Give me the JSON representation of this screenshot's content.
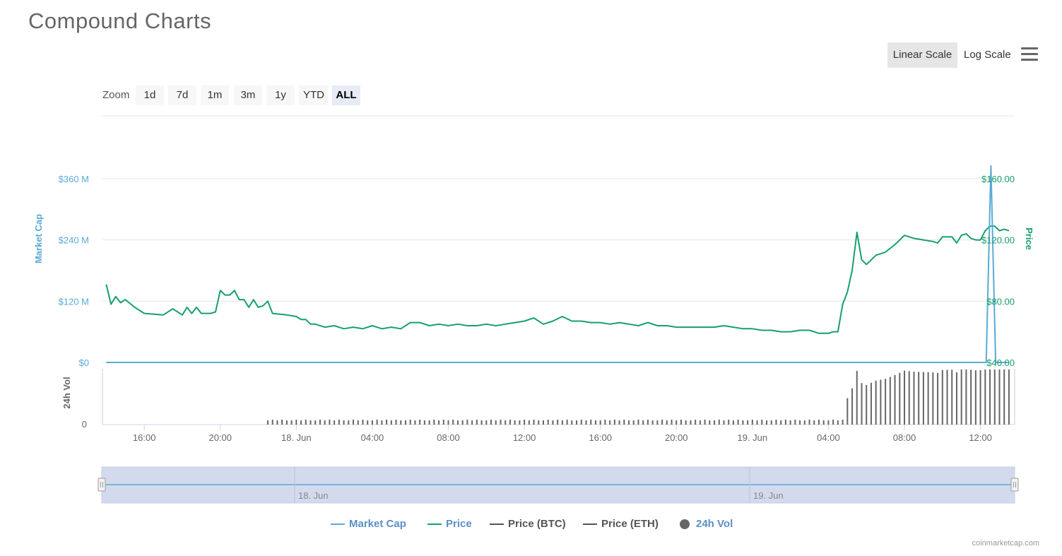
{
  "title": "Compound Charts",
  "scale_buttons": {
    "linear": "Linear Scale",
    "log": "Log Scale"
  },
  "menu_icon": "hamburger-menu-icon",
  "zoom": {
    "label": "Zoom",
    "buttons": [
      "1d",
      "7d",
      "1m",
      "3m",
      "1y",
      "YTD",
      "ALL"
    ],
    "active": "ALL"
  },
  "legend": [
    {
      "name": "Market Cap",
      "color": "#5aaad5",
      "kind": "line"
    },
    {
      "name": "Price",
      "color": "#16a06c",
      "kind": "line"
    },
    {
      "name": "Price (BTC)",
      "color": "#555555",
      "kind": "line"
    },
    {
      "name": "Price (ETH)",
      "color": "#555555",
      "kind": "line"
    },
    {
      "name": "24h Vol",
      "color": "#666666",
      "kind": "dot"
    }
  ],
  "credits": "coinmarketcap.com",
  "chart_data": {
    "type": "line",
    "x_ticks": [
      "16:00",
      "20:00",
      "18. Jun",
      "04:00",
      "08:00",
      "12:00",
      "16:00",
      "20:00",
      "19. Jun",
      "04:00",
      "08:00",
      "12:00"
    ],
    "x_range_hours": [
      -2.2,
      45.8
    ],
    "left_axis": {
      "label": "Market Cap",
      "ticks": [
        "$0",
        "$120 M",
        "$240 M",
        "$360 M"
      ],
      "values": [
        0,
        120,
        240,
        360
      ],
      "color": "#5aaad5"
    },
    "right_axis": {
      "label": "Price",
      "ticks": [
        "$40.00",
        "$80.00",
        "$120.00",
        "$160.00"
      ],
      "values": [
        40,
        80,
        120,
        160
      ],
      "color": "#16a06c"
    },
    "volume_axis": {
      "label": "24h Vol",
      "ticks": [
        "0"
      ]
    },
    "series": [
      {
        "name": "Price",
        "color": "#16a06c",
        "points": [
          [
            -2,
            91
          ],
          [
            -1.75,
            78
          ],
          [
            -1.5,
            83
          ],
          [
            -1.25,
            79
          ],
          [
            -1,
            81
          ],
          [
            -0.5,
            76
          ],
          [
            0,
            72
          ],
          [
            1,
            71
          ],
          [
            1.5,
            75
          ],
          [
            2,
            71
          ],
          [
            2.25,
            76
          ],
          [
            2.5,
            72
          ],
          [
            2.75,
            76
          ],
          [
            3,
            72
          ],
          [
            3.5,
            72
          ],
          [
            3.75,
            73
          ],
          [
            4,
            87
          ],
          [
            4.25,
            84
          ],
          [
            4.5,
            84
          ],
          [
            4.75,
            87
          ],
          [
            5,
            81
          ],
          [
            5.25,
            81
          ],
          [
            5.5,
            76
          ],
          [
            5.75,
            81
          ],
          [
            6,
            76
          ],
          [
            6.25,
            77
          ],
          [
            6.5,
            80
          ],
          [
            6.75,
            72
          ],
          [
            7.5,
            71
          ],
          [
            8,
            70
          ],
          [
            8.25,
            68
          ],
          [
            8.5,
            68
          ],
          [
            8.75,
            65
          ],
          [
            9,
            65
          ],
          [
            9.5,
            63
          ],
          [
            10,
            64
          ],
          [
            10.5,
            62
          ],
          [
            11,
            63
          ],
          [
            11.5,
            62
          ],
          [
            12,
            64
          ],
          [
            12.5,
            62
          ],
          [
            13,
            63
          ],
          [
            13.5,
            62
          ],
          [
            14,
            66
          ],
          [
            14.5,
            66
          ],
          [
            15,
            64
          ],
          [
            15.5,
            65
          ],
          [
            16,
            64
          ],
          [
            16.5,
            65
          ],
          [
            17,
            64
          ],
          [
            17.5,
            64
          ],
          [
            18,
            65
          ],
          [
            18.5,
            64
          ],
          [
            19,
            65
          ],
          [
            19.5,
            66
          ],
          [
            20,
            67
          ],
          [
            20.5,
            69
          ],
          [
            21,
            65
          ],
          [
            21.5,
            67
          ],
          [
            22,
            70
          ],
          [
            22.5,
            67
          ],
          [
            23,
            67
          ],
          [
            23.5,
            66
          ],
          [
            24,
            66
          ],
          [
            24.5,
            65
          ],
          [
            25,
            66
          ],
          [
            25.5,
            65
          ],
          [
            26,
            64
          ],
          [
            26.5,
            66
          ],
          [
            27,
            64
          ],
          [
            27.5,
            64
          ],
          [
            28,
            63
          ],
          [
            28.5,
            63
          ],
          [
            29,
            63
          ],
          [
            29.5,
            63
          ],
          [
            30,
            63
          ],
          [
            30.5,
            64
          ],
          [
            31,
            63
          ],
          [
            31.5,
            62
          ],
          [
            32,
            62
          ],
          [
            32.5,
            61
          ],
          [
            33,
            61
          ],
          [
            33.5,
            60
          ],
          [
            34,
            60
          ],
          [
            34.5,
            61
          ],
          [
            35,
            61
          ],
          [
            35.5,
            59
          ],
          [
            36,
            59
          ],
          [
            36.25,
            60
          ],
          [
            36.5,
            60
          ],
          [
            36.75,
            78
          ],
          [
            37,
            86
          ],
          [
            37.25,
            100
          ],
          [
            37.5,
            125
          ],
          [
            37.75,
            107
          ],
          [
            38,
            104
          ],
          [
            38.5,
            110
          ],
          [
            39,
            112
          ],
          [
            39.5,
            117
          ],
          [
            39.75,
            120
          ],
          [
            40,
            123
          ],
          [
            40.5,
            121
          ],
          [
            41,
            120
          ],
          [
            41.5,
            119
          ],
          [
            41.75,
            118
          ],
          [
            42,
            122
          ],
          [
            42.5,
            122
          ],
          [
            42.75,
            118
          ],
          [
            43,
            123
          ],
          [
            43.25,
            124
          ],
          [
            43.5,
            121
          ],
          [
            43.75,
            120
          ],
          [
            44,
            120
          ],
          [
            44.25,
            126
          ],
          [
            44.5,
            129
          ],
          [
            44.75,
            129
          ],
          [
            45,
            126
          ],
          [
            45.25,
            127
          ],
          [
            45.5,
            126
          ]
        ]
      },
      {
        "name": "Market Cap",
        "color": "#5aaad5",
        "points": [
          [
            -2,
            0
          ],
          [
            44.3,
            0
          ],
          [
            44.55,
            385
          ],
          [
            44.8,
            0
          ],
          [
            45.5,
            0
          ]
        ]
      }
    ]
  }
}
